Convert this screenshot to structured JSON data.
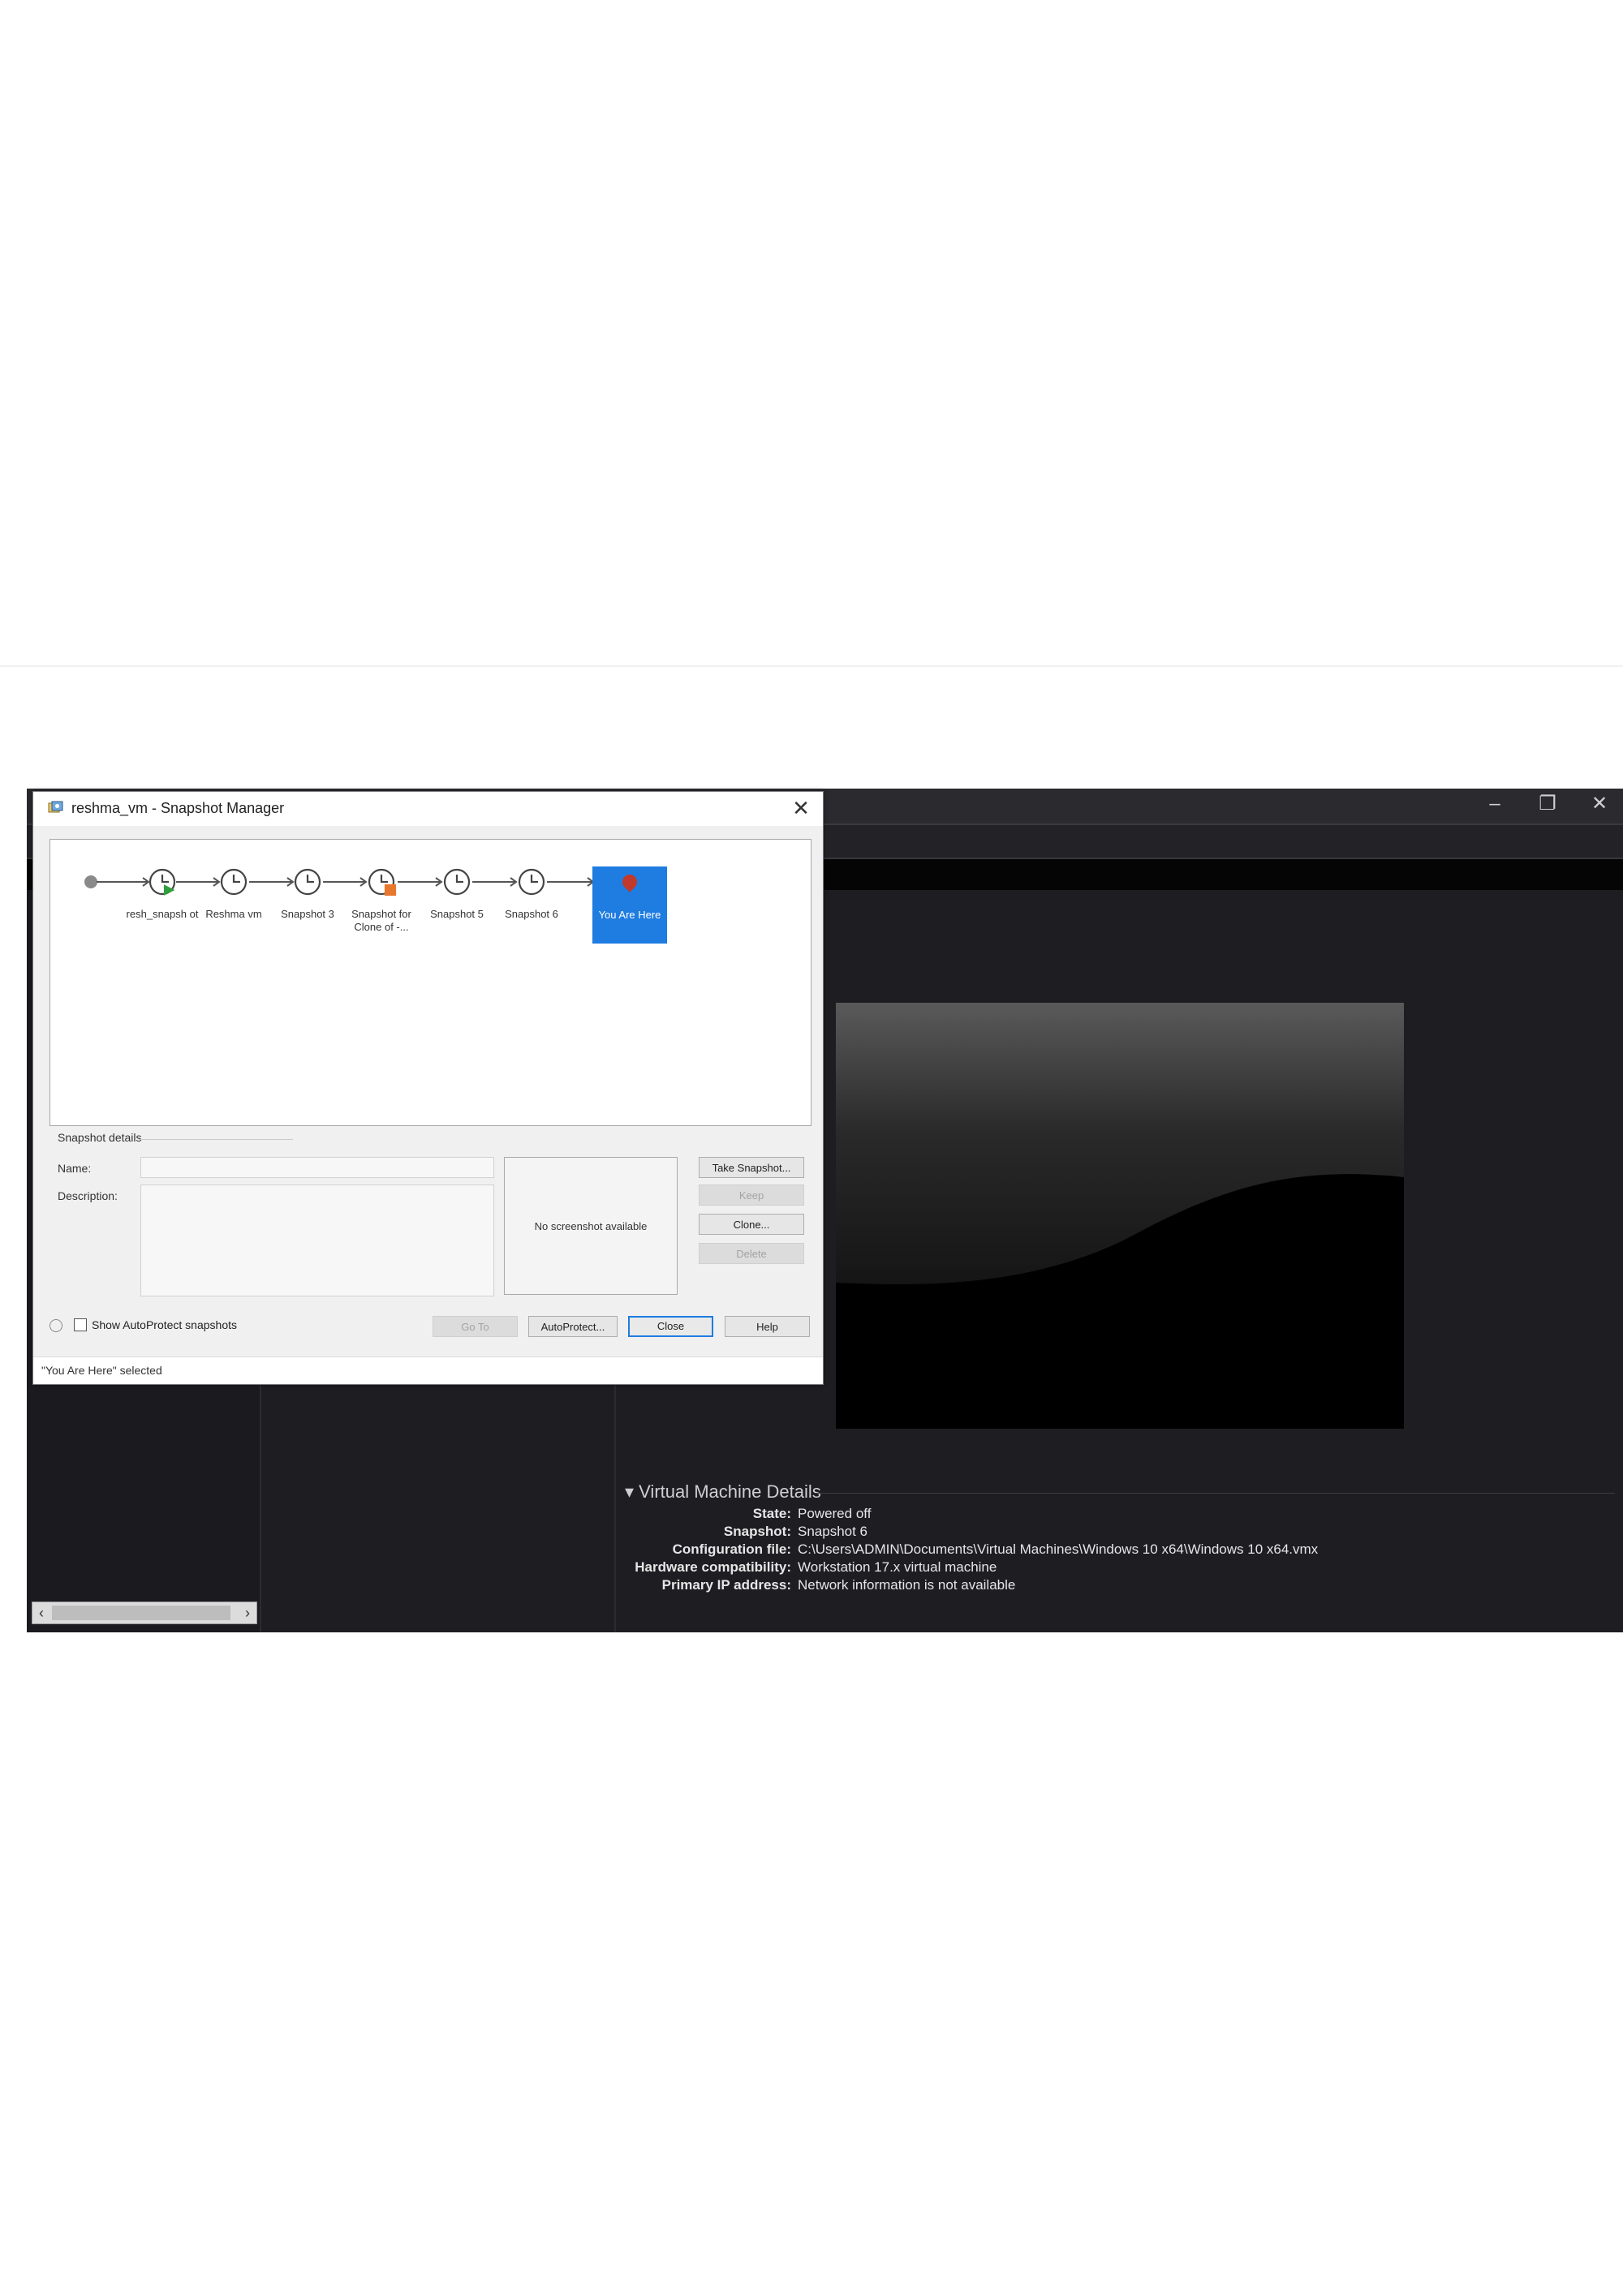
{
  "dialog": {
    "title": "reshma_vm - Snapshot Manager",
    "close_glyph": "✕",
    "snapshots": [
      {
        "label": "resh_snapsh ot",
        "icon": "clock-icon-green"
      },
      {
        "label": "Reshma vm",
        "icon": "clock-icon"
      },
      {
        "label": "Snapshot 3",
        "icon": "clock-icon"
      },
      {
        "label": "Snapshot for Clone of -...",
        "icon": "clock-icon-orange"
      },
      {
        "label": "Snapshot 5",
        "icon": "clock-icon"
      },
      {
        "label": "Snapshot 6",
        "icon": "clock-icon"
      }
    ],
    "you_are_here": "You Are Here",
    "details": {
      "legend": "Snapshot details",
      "name_label": "Name:",
      "name_value": "",
      "description_label": "Description:",
      "description_value": "",
      "screenshot_text": "No screenshot available"
    },
    "buttons": {
      "take_snapshot": "Take Snapshot...",
      "keep": "Keep",
      "clone": "Clone...",
      "delete": "Delete",
      "go_to": "Go To",
      "autoprotect": "AutoProtect...",
      "close": "Close",
      "help": "Help"
    },
    "show_autoprotect": "Show AutoProtect snapshots",
    "status": "\"You Are Here\" selected"
  },
  "host": {
    "window_controls": {
      "minimize": "–",
      "restore": "❐",
      "close": "✕"
    },
    "scroll_left": "‹",
    "scroll_right": "›",
    "vm_details": {
      "title": "Virtual Machine Details",
      "rows": [
        {
          "label": "State:",
          "value": "Powered off"
        },
        {
          "label": "Snapshot:",
          "value": "Snapshot 6"
        },
        {
          "label": "Configuration file:",
          "value": "C:\\Users\\ADMIN\\Documents\\Virtual Machines\\Windows 10 x64\\Windows 10 x64.vmx"
        },
        {
          "label": "Hardware compatibility:",
          "value": "Workstation 17.x virtual machine"
        },
        {
          "label": "Primary IP address:",
          "value": "Network information is not available"
        }
      ]
    }
  },
  "colors": {
    "accent": "#1f7ce0",
    "host_bg": "#1e1d22",
    "snapshot_current": "#2e9e3e",
    "snapshot_clone": "#e8772e"
  }
}
